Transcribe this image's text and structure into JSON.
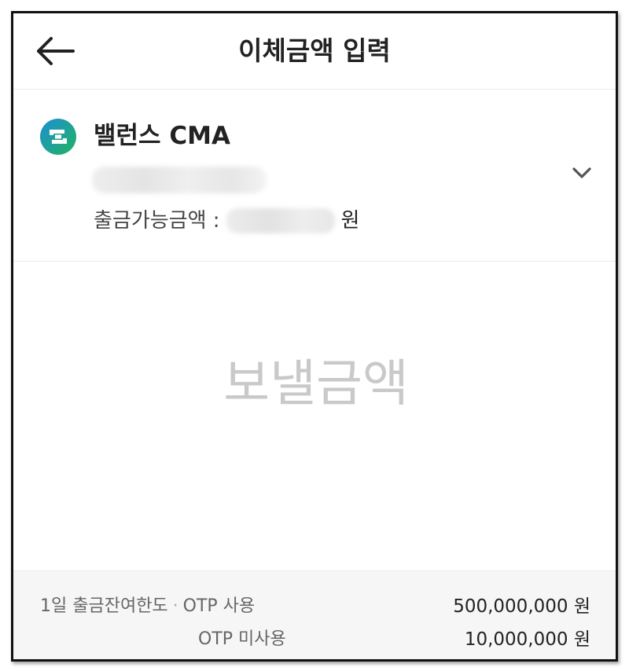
{
  "header": {
    "title": "이체금액 입력",
    "back_icon": "arrow-left-icon"
  },
  "account": {
    "name": "밸런스 CMA",
    "logo_icon": "cma-logo-icon",
    "expand_icon": "chevron-down-icon",
    "balance_label": "출금가능금액 :",
    "balance_unit": "원"
  },
  "amount": {
    "placeholder": "보낼금액",
    "value": ""
  },
  "limits": {
    "daily_label": "1일 출금잔여한도",
    "separator": "·",
    "otp_used_label": "OTP 사용",
    "otp_used_value": "500,000,000 원",
    "otp_unused_label": "OTP 미사용",
    "otp_unused_value": "10,000,000 원"
  },
  "colors": {
    "logo_blue": "#1c8fd6",
    "logo_green": "#22b35e",
    "text_primary": "#222222",
    "placeholder": "#c9c9c9"
  }
}
